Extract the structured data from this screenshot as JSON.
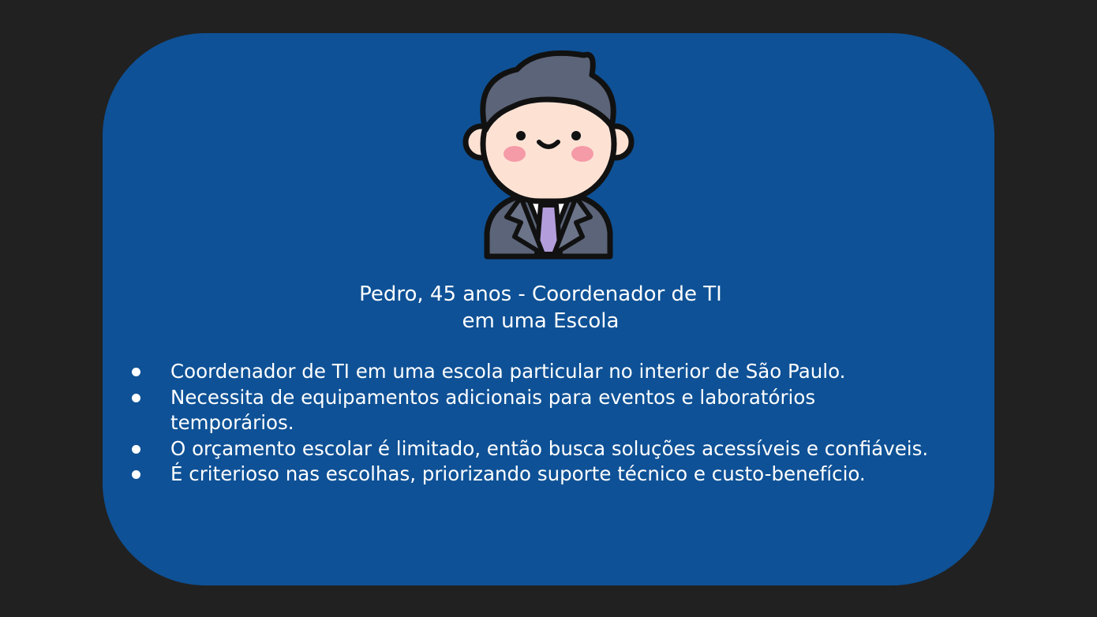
{
  "colors": {
    "page_background": "#212121",
    "card_background": "#0e5196",
    "text": "#ffffff"
  },
  "avatar": {
    "icon": "businessman-avatar-icon"
  },
  "title": {
    "line1": "Pedro, 45 anos - Coordenador de TI",
    "line2": "em uma Escola"
  },
  "bullets": [
    "Coordenador de TI em uma escola particular no interior de São Paulo.",
    "Necessita de equipamentos adicionais para eventos e laboratórios temporários.",
    "O orçamento escolar é limitado, então busca soluções acessíveis e confiáveis.",
    "É criterioso nas escolhas, priorizando suporte técnico e custo-benefício."
  ]
}
